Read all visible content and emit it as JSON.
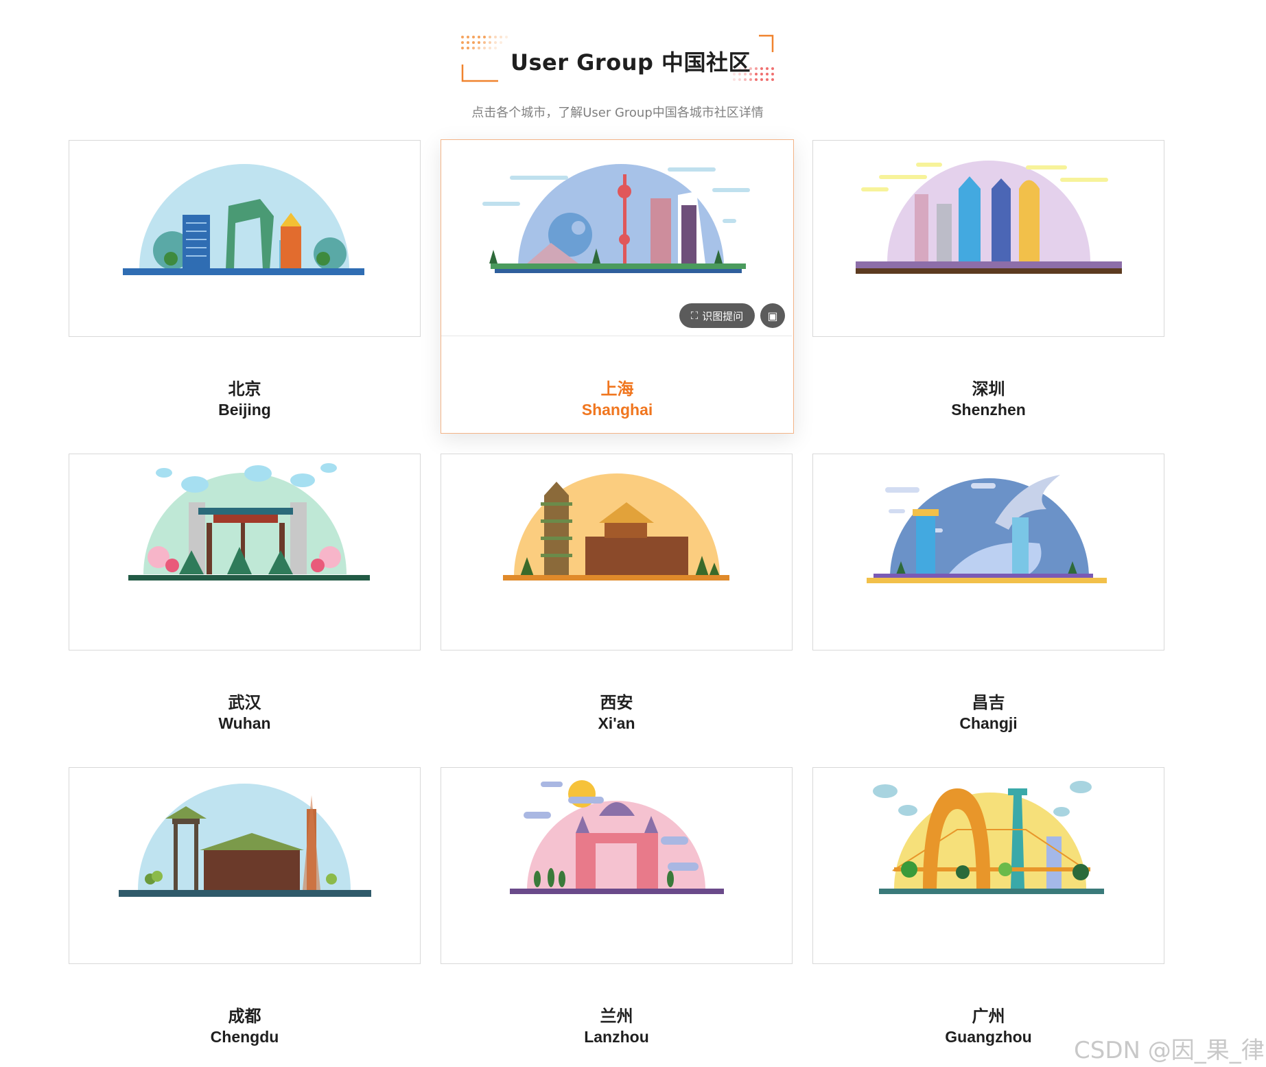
{
  "header": {
    "title": "User Group 中国社区",
    "subtitle": "点击各个城市，了解User Group中国各城市社区详情"
  },
  "cities": [
    {
      "cn": "北京",
      "en": "Beijing"
    },
    {
      "cn": "上海",
      "en": "Shanghai"
    },
    {
      "cn": "深圳",
      "en": "Shenzhen"
    },
    {
      "cn": "武汉",
      "en": "Wuhan"
    },
    {
      "cn": "西安",
      "en": "Xi'an"
    },
    {
      "cn": "昌吉",
      "en": "Changji"
    },
    {
      "cn": "成都",
      "en": "Chengdu"
    },
    {
      "cn": "兰州",
      "en": "Lanzhou"
    },
    {
      "cn": "广州",
      "en": "Guangzhou"
    }
  ],
  "hover_tools": {
    "ocr_label": "识图提问"
  },
  "watermark": "CSDN @因_果_律",
  "colors": {
    "accent": "#f0761f",
    "border": "#d8d8d8"
  }
}
